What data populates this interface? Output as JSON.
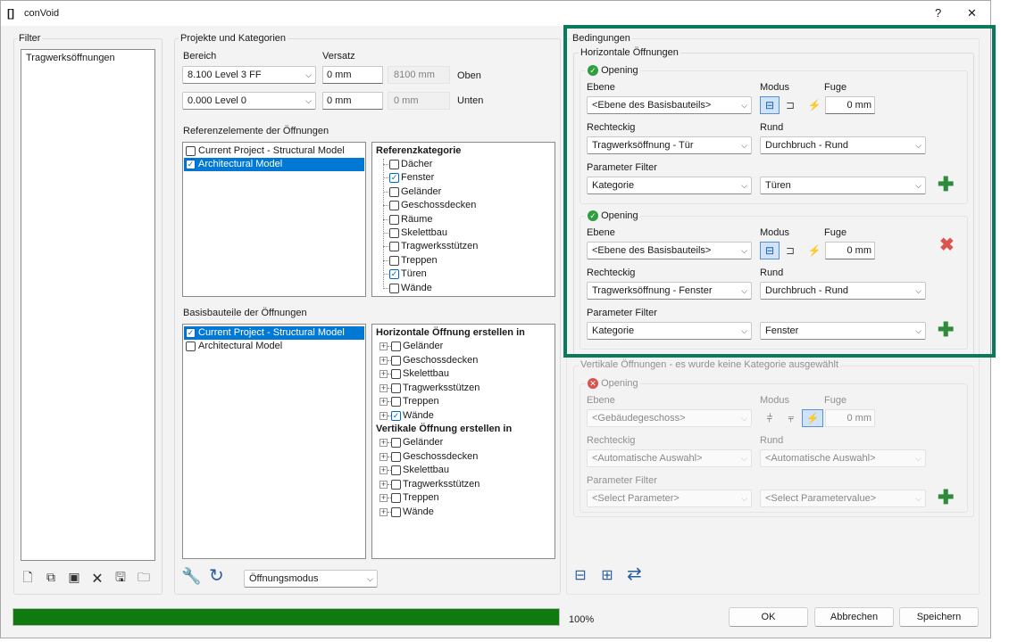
{
  "window": {
    "icon": "[]",
    "title": "conVoid",
    "help": "?",
    "close": "✕"
  },
  "filter": {
    "title": "Filter",
    "items": [
      "Tragwerksöffnungen"
    ]
  },
  "projects": {
    "title": "Projekte und Kategorien",
    "bereich_label": "Bereich",
    "versatz_label": "Versatz",
    "top_level": "8.100  Level 3 FF",
    "top_offset": "0 mm",
    "top_elevation": "8100 mm",
    "top_label": "Oben",
    "bottom_level": "0.000  Level 0",
    "bottom_offset": "0 mm",
    "bottom_elevation": "0 mm",
    "bottom_label": "Unten",
    "ref_title": "Referenzelemente der Öffnungen",
    "ref_models": [
      {
        "label": "Current Project - Structural Model",
        "checked": false
      },
      {
        "label": "Architectural Model",
        "checked": true
      }
    ],
    "ref_cat_header": "Referenzkategorie",
    "ref_categories": [
      {
        "label": "Dächer",
        "checked": false
      },
      {
        "label": "Fenster",
        "checked": true
      },
      {
        "label": "Geländer",
        "checked": false
      },
      {
        "label": "Geschossdecken",
        "checked": false
      },
      {
        "label": "Räume",
        "checked": false
      },
      {
        "label": "Skelettbau",
        "checked": false
      },
      {
        "label": "Tragwerksstützen",
        "checked": false
      },
      {
        "label": "Treppen",
        "checked": false
      },
      {
        "label": "Türen",
        "checked": true
      },
      {
        "label": "Wände",
        "checked": false
      }
    ],
    "base_title": "Basisbauteile der Öffnungen",
    "base_models": [
      {
        "label": "Current Project - Structural Model",
        "checked": true
      },
      {
        "label": "Architectural Model",
        "checked": false
      }
    ],
    "horiz_header": "Horizontale Öffnung erstellen in",
    "horiz_items": [
      {
        "label": "Geländer",
        "checked": false
      },
      {
        "label": "Geschossdecken",
        "checked": false
      },
      {
        "label": "Skelettbau",
        "checked": false
      },
      {
        "label": "Tragwerksstützen",
        "checked": false
      },
      {
        "label": "Treppen",
        "checked": false
      },
      {
        "label": "Wände",
        "checked": true
      }
    ],
    "vert_header": "Vertikale Öffnung erstellen in",
    "vert_items": [
      {
        "label": "Geländer",
        "checked": false
      },
      {
        "label": "Geschossdecken",
        "checked": false
      },
      {
        "label": "Skelettbau",
        "checked": false
      },
      {
        "label": "Tragwerksstützen",
        "checked": false
      },
      {
        "label": "Treppen",
        "checked": false
      },
      {
        "label": "Wände",
        "checked": false
      }
    ],
    "mode_select": "Öffnungsmodus"
  },
  "conditions": {
    "title": "Bedingungen",
    "horiz_title": "Horizontale Öffnungen",
    "openings": [
      {
        "title": "Opening",
        "ebene_label": "Ebene",
        "modus_label": "Modus",
        "fuge_label": "Fuge",
        "ebene": "<Ebene des Basisbauteils>",
        "fuge": "0 mm",
        "rect_label": "Rechteckig",
        "rund_label": "Rund",
        "rect": "Tragwerksöffnung - Tür",
        "rund": "Durchbruch - Rund",
        "param_label": "Parameter Filter",
        "param": "Kategorie",
        "param_value": "Türen"
      },
      {
        "title": "Opening",
        "ebene_label": "Ebene",
        "modus_label": "Modus",
        "fuge_label": "Fuge",
        "ebene": "<Ebene des Basisbauteils>",
        "fuge": "0 mm",
        "rect_label": "Rechteckig",
        "rund_label": "Rund",
        "rect": "Tragwerksöffnung - Fenster",
        "rund": "Durchbruch - Rund",
        "param_label": "Parameter Filter",
        "param": "Kategorie",
        "param_value": "Fenster"
      }
    ],
    "vert_title": "Vertikale Öffnungen - es wurde keine Kategorie ausgewählt",
    "vert": {
      "title": "Opening",
      "ebene_label": "Ebene",
      "modus_label": "Modus",
      "fuge_label": "Fuge",
      "ebene": "<Gebäudegeschoss>",
      "fuge": "0 mm",
      "rect_label": "Rechteckig",
      "rund_label": "Rund",
      "rect": "<Automatische Auswahl>",
      "rund": "<Automatische Auswahl>",
      "param_label": "Parameter Filter",
      "param": "<Select Parameter>",
      "param_value": "<Select Parametervalue>"
    }
  },
  "footer": {
    "progress_value": 1.0,
    "progress_text": "100%",
    "ok": "OK",
    "cancel": "Abbrechen",
    "save": "Speichern"
  },
  "colors": {
    "progress": "#0f7b0f",
    "selection": "#0078d4",
    "highlight": "#0a7a5a"
  }
}
